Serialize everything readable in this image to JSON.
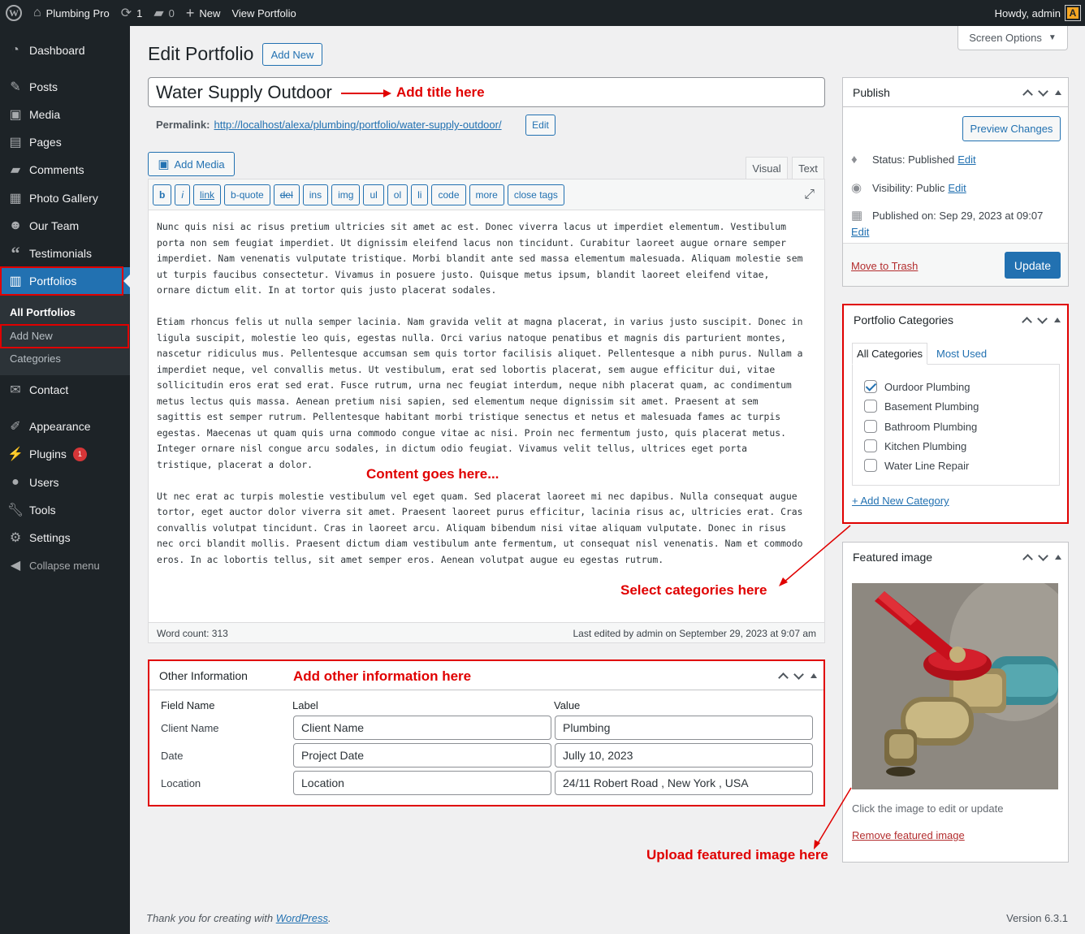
{
  "admin_bar": {
    "site_name": "Plumbing Pro",
    "updates_count": "1",
    "comments_count": "0",
    "new_label": "New",
    "view_label": "View Portfolio",
    "howdy": "Howdy, admin",
    "avatar_letter": "A"
  },
  "sidebar": {
    "items": [
      {
        "label": "Dashboard",
        "icon": "dashboard-icon"
      },
      {
        "label": "Posts",
        "icon": "pin-icon"
      },
      {
        "label": "Media",
        "icon": "media-icon"
      },
      {
        "label": "Pages",
        "icon": "pages-icon"
      },
      {
        "label": "Comments",
        "icon": "comments-icon"
      },
      {
        "label": "Photo Gallery",
        "icon": "gallery-icon"
      },
      {
        "label": "Our Team",
        "icon": "groups-icon"
      },
      {
        "label": "Testimonials",
        "icon": "quote-icon"
      },
      {
        "label": "Portfolios",
        "icon": "portfolio-icon"
      },
      {
        "label": "Contact",
        "icon": "mail-icon"
      },
      {
        "label": "Appearance",
        "icon": "brush-icon"
      },
      {
        "label": "Plugins",
        "icon": "plugin-icon",
        "badge": "1"
      },
      {
        "label": "Users",
        "icon": "users-icon"
      },
      {
        "label": "Tools",
        "icon": "wrench-icon"
      },
      {
        "label": "Settings",
        "icon": "settings-icon"
      },
      {
        "label": "Collapse menu",
        "icon": "collapse-icon"
      }
    ],
    "submenu": {
      "all": "All Portfolios",
      "add_new": "Add New",
      "categories": "Categories"
    }
  },
  "screen_options": "Screen Options",
  "page": {
    "title": "Edit Portfolio",
    "add_new": "Add New",
    "post_title": "Water Supply Outdoor",
    "permalink_label": "Permalink:",
    "permalink_url": "http://localhost/alexa/plumbing/portfolio/water-supply-outdoor/",
    "permalink_edit": "Edit"
  },
  "editor": {
    "add_media": "Add Media",
    "tab_visual": "Visual",
    "tab_text": "Text",
    "quicktags": [
      "b",
      "i",
      "link",
      "b-quote",
      "del",
      "ins",
      "img",
      "ul",
      "ol",
      "li",
      "code",
      "more",
      "close tags"
    ],
    "paragraphs": [
      "Nunc quis nisi ac risus pretium ultricies sit amet ac est. Donec viverra lacus ut imperdiet elementum. Vestibulum\nporta non sem feugiat imperdiet. Ut dignissim eleifend lacus non tincidunt. Curabitur laoreet augue ornare semper\nimperdiet. Nam venenatis vulputate tristique. Morbi blandit ante sed massa elementum malesuada. Aliquam molestie sem\nut turpis faucibus consectetur. Vivamus in posuere justo. Quisque metus ipsum, blandit laoreet eleifend vitae,\nornare dictum elit. In at tortor quis justo placerat sodales.",
      "Etiam rhoncus felis ut nulla semper lacinia. Nam gravida velit at magna placerat, in varius justo suscipit. Donec in\nligula suscipit, molestie leo quis, egestas nulla. Orci varius natoque penatibus et magnis dis parturient montes,\nnascetur ridiculus mus. Pellentesque accumsan sem quis tortor facilisis aliquet. Pellentesque a nibh purus. Nullam a\nimperdiet neque, vel convallis metus. Ut vestibulum, erat sed lobortis placerat, sem augue efficitur dui, vitae\nsollicitudin eros erat sed erat. Fusce rutrum, urna nec feugiat interdum, neque nibh placerat quam, ac condimentum\nmetus lectus quis massa. Aenean pretium nisi sapien, sed elementum neque dignissim sit amet. Praesent at sem\nsagittis est semper rutrum. Pellentesque habitant morbi tristique senectus et netus et malesuada fames ac turpis\negestas. Maecenas ut quam quis urna commodo congue vitae ac nisi. Proin nec fermentum justo, quis placerat metus.\nInteger ornare nisl congue arcu sodales, in dictum odio feugiat. Vivamus velit tellus, ultrices eget porta\ntristique, placerat a dolor.",
      "Ut nec erat ac turpis molestie vestibulum vel eget quam. Sed placerat laoreet mi nec dapibus. Nulla consequat augue\ntortor, eget auctor dolor viverra sit amet. Praesent laoreet purus efficitur, lacinia risus ac, ultricies erat. Cras\nconvallis volutpat tincidunt. Cras in laoreet arcu. Aliquam bibendum nisi vitae aliquam vulputate. Donec in risus\nnec orci blandit mollis. Praesent dictum diam vestibulum ante fermentum, ut consequat nisl venenatis. Nam et commodo\neros. In ac lobortis tellus, sit amet semper eros. Aenean volutpat augue eu egestas rutrum."
    ],
    "word_count": "Word count: 313",
    "last_edited": "Last edited by admin on September 29, 2023 at 9:07 am"
  },
  "annotations": {
    "title": "Add title here",
    "content": "Content goes here...",
    "categories": "Select categories here",
    "other_info": "Add other information here",
    "featured": "Upload featured image here"
  },
  "other_info": {
    "title": "Other Information",
    "col_field": "Field Name",
    "col_label": "Label",
    "col_value": "Value",
    "rows": [
      {
        "field": "Client Name",
        "label": "Client Name",
        "value": "Plumbing"
      },
      {
        "field": "Date",
        "label": "Project Date",
        "value": "Jully 10, 2023"
      },
      {
        "field": "Location",
        "label": "Location",
        "value": "24/11 Robert Road , New York , USA"
      }
    ]
  },
  "publish": {
    "title": "Publish",
    "preview": "Preview Changes",
    "status": "Status: Published",
    "visibility": "Visibility: Public",
    "published_on": "Published on: Sep 29, 2023 at 09:07",
    "edit": "Edit",
    "trash": "Move to Trash",
    "update": "Update"
  },
  "categories": {
    "title": "Portfolio Categories",
    "tab_all": "All Categories",
    "tab_most_used": "Most Used",
    "items": [
      {
        "label": "Ourdoor Plumbing",
        "checked": true
      },
      {
        "label": "Basement Plumbing",
        "checked": false
      },
      {
        "label": "Bathroom Plumbing",
        "checked": false
      },
      {
        "label": "Kitchen Plumbing",
        "checked": false
      },
      {
        "label": "Water Line Repair",
        "checked": false
      }
    ],
    "add_new": "+ Add New Category"
  },
  "featured": {
    "title": "Featured image",
    "hint": "Click the image to edit or update",
    "remove": "Remove featured image"
  },
  "footer": {
    "thanks": "Thank you for creating with",
    "wp_link": "WordPress",
    "period": ".",
    "version": "Version 6.3.1"
  },
  "colors": {
    "accent": "#2271b1",
    "sidebar_bg": "#1d2327",
    "annotation": "#e00000"
  }
}
